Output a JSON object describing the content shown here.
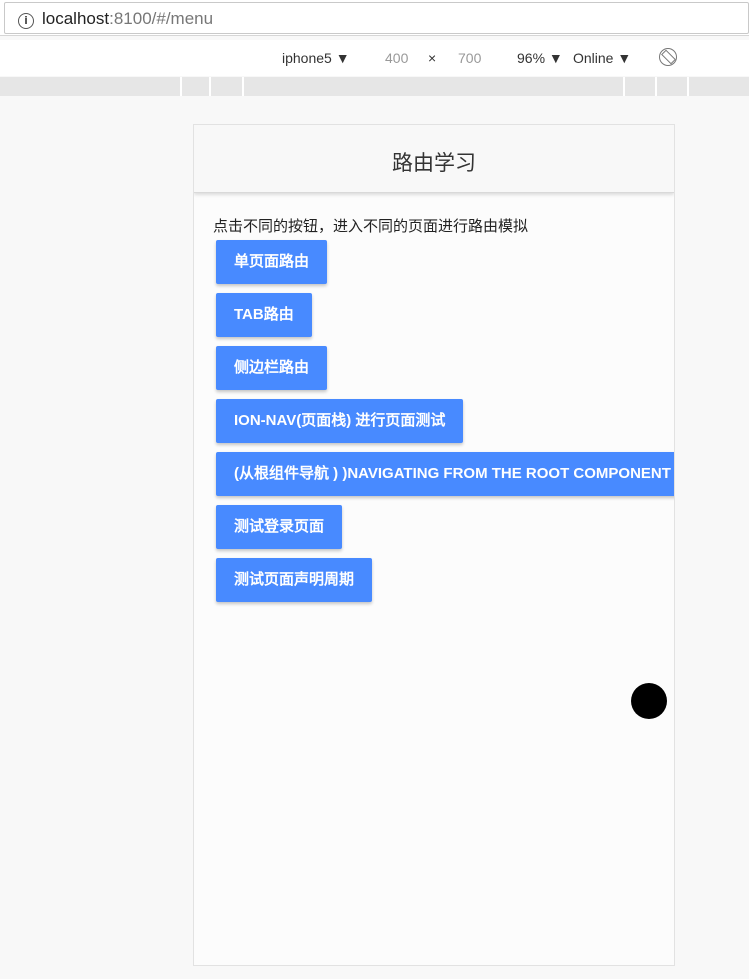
{
  "browser": {
    "url_host": "localhost",
    "url_rest": ":8100/#/menu"
  },
  "device_toolbar": {
    "device": "iphone5 ▼",
    "width": "400",
    "times": "×",
    "height": "700",
    "zoom": "96% ▼",
    "network": "Online ▼"
  },
  "app": {
    "title": "路由学习",
    "description": "点击不同的按钮，进入不同的页面进行路由模拟",
    "buttons": [
      "单页面路由",
      "TAB路由",
      "侧边栏路由",
      "ION-NAV(页面栈) 进行页面测试",
      "(从根组件导航 ) )NAVIGATING FROM THE ROOT COMPONENT",
      "测试登录页面",
      "测试页面声明周期"
    ]
  },
  "colors": {
    "button": "#488aff"
  }
}
